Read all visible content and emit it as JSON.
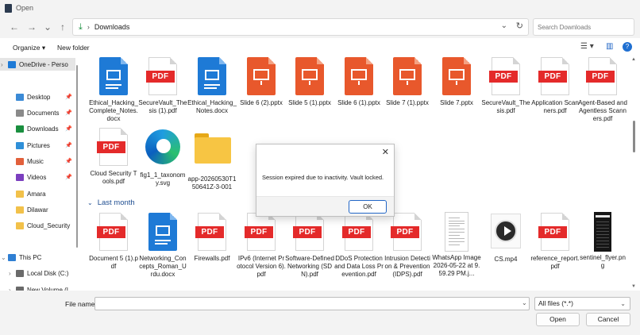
{
  "window": {
    "title": "Open"
  },
  "nav": {
    "back": "←",
    "forward": "→",
    "recent": "⌄",
    "up": "↑",
    "breadcrumb_icon": "⤓",
    "breadcrumb_sep": "›",
    "path": "Downloads",
    "refresh": "↻",
    "search_placeholder": "Search Downloads"
  },
  "toolbar": {
    "organize": "Organize ▾",
    "new_folder": "New folder",
    "view_icon": "☰ ▾",
    "pane_icon": "▥",
    "help_icon": "?"
  },
  "sidebar": {
    "items": [
      {
        "label": "OneDrive - Perso",
        "icon": "onedrive-icon",
        "color": "#1e7ad6",
        "pin": ""
      },
      {
        "label": "Desktop",
        "icon": "desktop-icon",
        "color": "#3b8ad6",
        "pin": "📌"
      },
      {
        "label": "Documents",
        "icon": "documents-icon",
        "color": "#8a8a8a",
        "pin": "📌"
      },
      {
        "label": "Downloads",
        "icon": "downloads-icon",
        "color": "#1a8f3f",
        "pin": "📌"
      },
      {
        "label": "Pictures",
        "icon": "pictures-icon",
        "color": "#2f8fd8",
        "pin": "📌"
      },
      {
        "label": "Music",
        "icon": "music-icon",
        "color": "#e2603b",
        "pin": "📌"
      },
      {
        "label": "Videos",
        "icon": "videos-icon",
        "color": "#7b3fbf",
        "pin": "📌"
      },
      {
        "label": "Amara",
        "icon": "folder-icon",
        "color": "#f2c14a",
        "pin": ""
      },
      {
        "label": "Dilawar",
        "icon": "folder-icon",
        "color": "#f2c14a",
        "pin": ""
      },
      {
        "label": "Cloud_Security",
        "icon": "folder-icon",
        "color": "#f2c14a",
        "pin": ""
      },
      {
        "label": "This PC",
        "icon": "pc-icon",
        "color": "#2f7fd3",
        "pin": ""
      },
      {
        "label": "Local Disk (C:)",
        "icon": "disk-icon",
        "color": "#6a6a6a",
        "pin": ""
      },
      {
        "label": "New Volume (I",
        "icon": "disk-icon",
        "color": "#6a6a6a",
        "pin": ""
      }
    ]
  },
  "files_recent": [
    {
      "name": "Ethical_Hacking_Complete_Notes.docx",
      "type": "docx"
    },
    {
      "name": "SecureVault_Thesis (1).pdf",
      "type": "pdf"
    },
    {
      "name": "Ethical_Hacking_Notes.docx",
      "type": "docx"
    },
    {
      "name": "Slide 6 (2).pptx",
      "type": "pptx"
    },
    {
      "name": "Slide 5 (1).pptx",
      "type": "pptx"
    },
    {
      "name": "Slide 6 (1).pptx",
      "type": "pptx"
    },
    {
      "name": "Slide 7 (1).pptx",
      "type": "pptx"
    },
    {
      "name": "Slide 7.pptx",
      "type": "pptx"
    },
    {
      "name": "SecureVault_Thesis.pdf",
      "type": "pdf"
    },
    {
      "name": "Application Scanners.pdf",
      "type": "pdf"
    },
    {
      "name": "Agent-Based and Agentless Scanners.pdf",
      "type": "pdf"
    },
    {
      "name": "Cloud Security Tools.pdf",
      "type": "pdf"
    },
    {
      "name": "fig1_1_taxonomy.svg",
      "type": "svg"
    },
    {
      "name": "app-20260530T150641Z-3-001",
      "type": "folder"
    }
  ],
  "group_last_month": {
    "label": "Last month",
    "chevron": "⌄"
  },
  "files_last_month": [
    {
      "name": "Document 5 (1).pdf",
      "type": "pdf"
    },
    {
      "name": "Networking_Concepts_Roman_Urdu.docx",
      "type": "docx"
    },
    {
      "name": "Firewalls.pdf",
      "type": "pdf"
    },
    {
      "name": "IPv6 (Internet Protocol Version 6).pdf",
      "type": "pdf"
    },
    {
      "name": "Software-Defined Networking (SDN).pdf",
      "type": "pdf"
    },
    {
      "name": "DDoS Protection and Data Loss Prevention.pdf",
      "type": "pdf"
    },
    {
      "name": "Intrusion Detection & Prevention (IDPS).pdf",
      "type": "pdf"
    },
    {
      "name": "WhatsApp Image 2026-05-22 at 9.59.29 PM.j...",
      "type": "image"
    },
    {
      "name": "CS.mp4",
      "type": "mp4"
    },
    {
      "name": "reference_report.pdf",
      "type": "pdf"
    },
    {
      "name": "sentinel_flyer.png",
      "type": "png"
    }
  ],
  "pdf_band": "PDF",
  "bottom": {
    "file_name_label": "File name:",
    "file_name_value": "",
    "filter": "All files (*.*)",
    "open": "Open",
    "cancel": "Cancel"
  },
  "modal": {
    "close": "✕",
    "message": "Session expired due to inactivity. Vault locked.",
    "ok": "OK"
  },
  "colors": {
    "pdf_red": "#e42a2a",
    "docx_blue": "#1e7ad6",
    "pptx_orange": "#e8582c",
    "group_blue": "#1f4e91",
    "ok_border": "#2266c6"
  }
}
